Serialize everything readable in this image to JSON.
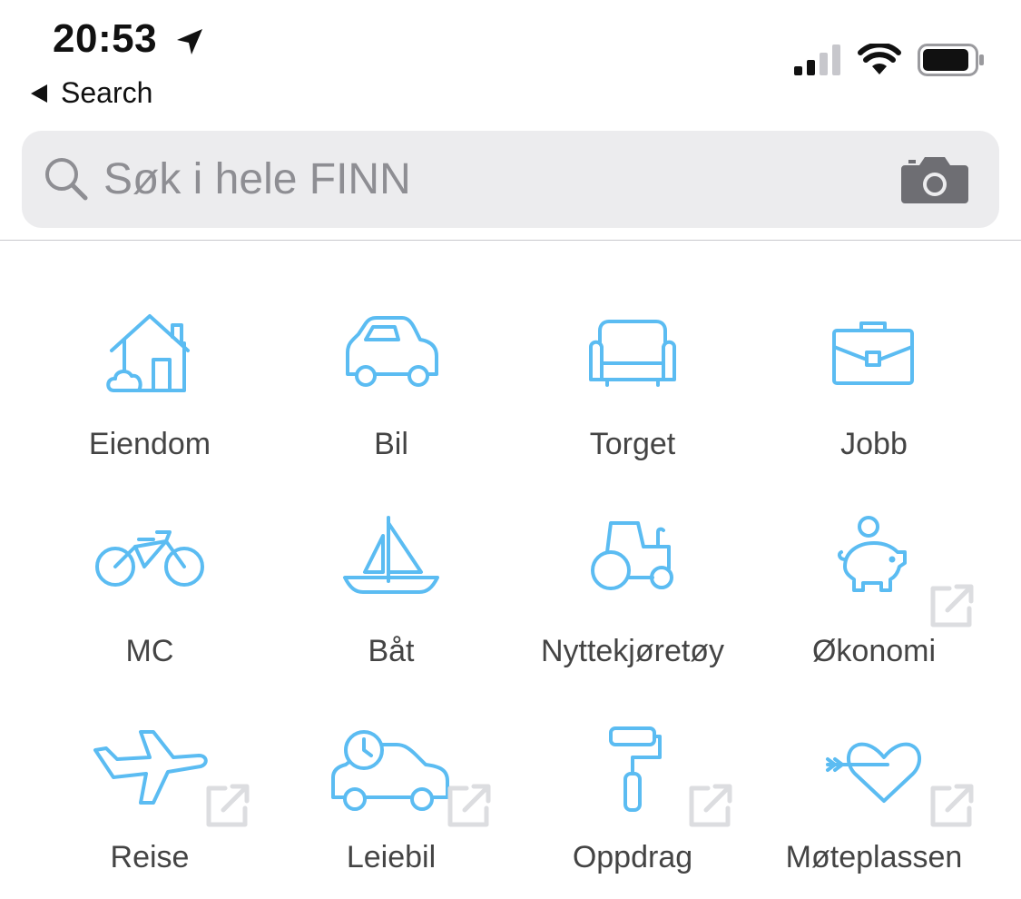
{
  "status_bar": {
    "time": "20:53",
    "back_label": "Search"
  },
  "search": {
    "placeholder": "Søk i hele FINN"
  },
  "categories": [
    {
      "label": "Eiendom",
      "icon": "house-icon",
      "external": false
    },
    {
      "label": "Bil",
      "icon": "car-icon",
      "external": false
    },
    {
      "label": "Torget",
      "icon": "sofa-icon",
      "external": false
    },
    {
      "label": "Jobb",
      "icon": "briefcase-icon",
      "external": false
    },
    {
      "label": "MC",
      "icon": "bicycle-icon",
      "external": false
    },
    {
      "label": "Båt",
      "icon": "sailboat-icon",
      "external": false
    },
    {
      "label": "Nyttekjøretøy",
      "icon": "tractor-icon",
      "external": false
    },
    {
      "label": "Økonomi",
      "icon": "piggy-bank-icon",
      "external": true
    },
    {
      "label": "Reise",
      "icon": "airplane-icon",
      "external": true
    },
    {
      "label": "Leiebil",
      "icon": "rental-car-icon",
      "external": true
    },
    {
      "label": "Oppdrag",
      "icon": "paint-roller-icon",
      "external": true
    },
    {
      "label": "Møteplassen",
      "icon": "heart-arrow-icon",
      "external": true
    }
  ],
  "colors": {
    "icon_blue": "#5bbcf2",
    "external_gray": "#dcdde0",
    "search_bg": "#ececee"
  }
}
